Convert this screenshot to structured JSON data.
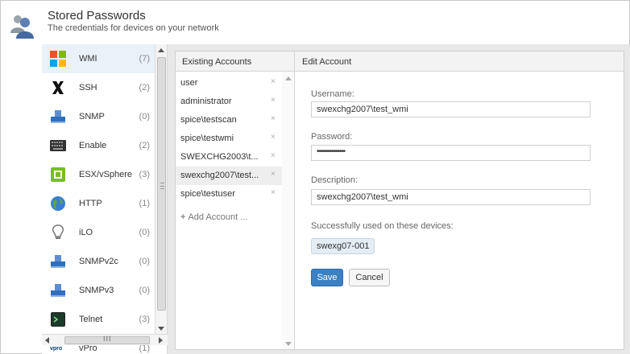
{
  "header": {
    "title": "Stored Passwords",
    "subtitle": "The credentials for devices on your network"
  },
  "types": [
    {
      "label": "WMI",
      "count": "(7)",
      "icon": "windows-icon",
      "selected": true
    },
    {
      "label": "SSH",
      "count": "(2)",
      "icon": "ssh-icon"
    },
    {
      "label": "SNMP",
      "count": "(0)",
      "icon": "network-printer-icon"
    },
    {
      "label": "Enable",
      "count": "(2)",
      "icon": "keyboard-icon"
    },
    {
      "label": "ESX/vSphere",
      "count": "(3)",
      "icon": "vmware-icon"
    },
    {
      "label": "HTTP",
      "count": "(1)",
      "icon": "globe-icon"
    },
    {
      "label": "iLO",
      "count": "(0)",
      "icon": "lightbulb-icon"
    },
    {
      "label": "SNMPv2c",
      "count": "(0)",
      "icon": "network-printer-icon"
    },
    {
      "label": "SNMPv3",
      "count": "(0)",
      "icon": "network-printer-icon"
    },
    {
      "label": "Telnet",
      "count": "(3)",
      "icon": "terminal-icon"
    },
    {
      "label": "vPro",
      "count": "(1)",
      "icon": "vpro-icon"
    }
  ],
  "hscroll_grip": "III",
  "panel": {
    "existing_header": "Existing Accounts",
    "edit_header": "Edit Account"
  },
  "accounts": [
    {
      "label": "user"
    },
    {
      "label": "administrator"
    },
    {
      "label": "spice\\testscan"
    },
    {
      "label": "spice\\testwmi"
    },
    {
      "label": "SWEXCHG2003\\t..."
    },
    {
      "label": "swexchg2007\\test...",
      "selected": true
    },
    {
      "label": "spice\\testuser"
    }
  ],
  "remove_glyph": "×",
  "add_account": "Add Account ...",
  "form": {
    "username_label": "Username:",
    "username_value": "swexchg2007\\test_wmi",
    "password_label": "Password:",
    "password_value": "••••••••••••••",
    "description_label": "Description:",
    "description_value": "swexchg2007\\test_wmi",
    "used_on_label": "Successfully used on these devices:",
    "device": "swexg07-001",
    "save": "Save",
    "cancel": "Cancel"
  },
  "colors": {
    "save_button": "#3b80c2",
    "selection": "#eaf1f9"
  }
}
